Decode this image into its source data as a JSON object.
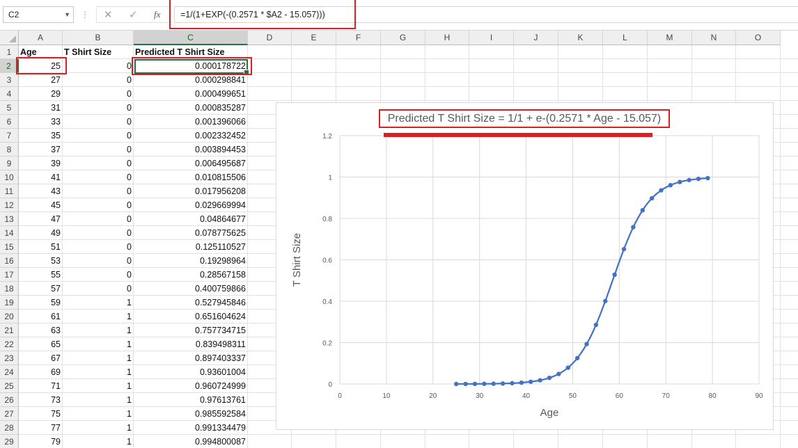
{
  "formula_bar": {
    "name_box": "C2",
    "cancel_icon": "✕",
    "enter_icon": "✓",
    "fx_label": "fx",
    "formula": "=1/(1+EXP(-(0.2571 * $A2 - 15.057)))"
  },
  "columns": [
    "A",
    "B",
    "C",
    "D",
    "E",
    "F",
    "G",
    "H",
    "I",
    "J",
    "K",
    "L",
    "M",
    "N",
    "O"
  ],
  "selected_column": "C",
  "selected_row": 2,
  "rows": [
    "1",
    "2",
    "3",
    "4",
    "5",
    "6",
    "7",
    "8",
    "9",
    "10",
    "11",
    "12",
    "13",
    "14",
    "15",
    "16",
    "17",
    "18",
    "19",
    "20",
    "21",
    "22",
    "23",
    "24",
    "25",
    "26",
    "27",
    "28",
    "29"
  ],
  "headers": {
    "a": "Age",
    "b": "T Shirt Size",
    "c": "Predicted T Shirt Size"
  },
  "data": [
    [
      "25",
      "0",
      "0.000178722"
    ],
    [
      "27",
      "0",
      "0.000298841"
    ],
    [
      "29",
      "0",
      "0.000499651"
    ],
    [
      "31",
      "0",
      "0.000835287"
    ],
    [
      "33",
      "0",
      "0.001396066"
    ],
    [
      "35",
      "0",
      "0.002332452"
    ],
    [
      "37",
      "0",
      "0.003894453"
    ],
    [
      "39",
      "0",
      "0.006495687"
    ],
    [
      "41",
      "0",
      "0.010815506"
    ],
    [
      "43",
      "0",
      "0.017956208"
    ],
    [
      "45",
      "0",
      "0.029669994"
    ],
    [
      "47",
      "0",
      "0.04864677"
    ],
    [
      "49",
      "0",
      "0.078775625"
    ],
    [
      "51",
      "0",
      "0.125110527"
    ],
    [
      "53",
      "0",
      "0.19298964"
    ],
    [
      "55",
      "0",
      "0.28567158"
    ],
    [
      "57",
      "0",
      "0.400759866"
    ],
    [
      "59",
      "1",
      "0.527945846"
    ],
    [
      "61",
      "1",
      "0.651604624"
    ],
    [
      "63",
      "1",
      "0.757734715"
    ],
    [
      "65",
      "1",
      "0.839498311"
    ],
    [
      "67",
      "1",
      "0.897403337"
    ],
    [
      "69",
      "1",
      "0.93601004"
    ],
    [
      "71",
      "1",
      "0.960724999"
    ],
    [
      "73",
      "1",
      "0.97613761"
    ],
    [
      "75",
      "1",
      "0.985592584"
    ],
    [
      "77",
      "1",
      "0.991334479"
    ],
    [
      "79",
      "1",
      "0.994800087"
    ]
  ],
  "colors": {
    "series": "#4472c4",
    "highlight": "#d92026",
    "selection": "#217346"
  },
  "chart_data": {
    "type": "scatter",
    "title": "Predicted T Shirt Size = 1/1 + e-(0.2571 * Age - 15.057)",
    "xlabel": "Age",
    "ylabel": "T Shirt Size",
    "xlim": [
      0,
      90
    ],
    "ylim": [
      0,
      1.2
    ],
    "xticks": [
      "0",
      "10",
      "20",
      "30",
      "40",
      "50",
      "60",
      "70",
      "80",
      "90"
    ],
    "yticks": [
      "0",
      "0.2",
      "0.4",
      "0.6",
      "0.8",
      "1",
      "1.2"
    ],
    "grid": true,
    "smooth_line": true,
    "series": [
      {
        "x": [
          25,
          27,
          29,
          31,
          33,
          35,
          37,
          39,
          41,
          43,
          45,
          47,
          49,
          51,
          53,
          55,
          57,
          59,
          61,
          63,
          65,
          67,
          69,
          71,
          73,
          75,
          77,
          79
        ],
        "values": [
          0.000178722,
          0.000298841,
          0.000499651,
          0.000835287,
          0.001396066,
          0.002332452,
          0.003894453,
          0.006495687,
          0.010815506,
          0.017956208,
          0.029669994,
          0.04864677,
          0.078775625,
          0.125110527,
          0.19298964,
          0.28567158,
          0.400759866,
          0.527945846,
          0.651604624,
          0.757734715,
          0.839498311,
          0.897403337,
          0.93601004,
          0.960724999,
          0.97613761,
          0.985592584,
          0.991334479,
          0.994800087
        ]
      }
    ]
  }
}
